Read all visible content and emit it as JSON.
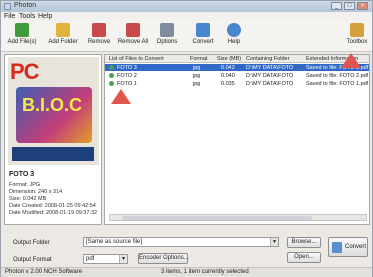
{
  "window": {
    "title": "Photon"
  },
  "menu": [
    "File",
    "Tools",
    "Help"
  ],
  "toolbar": [
    {
      "label": "Add File(s)",
      "icon": "add-files-icon",
      "color": "#3f9a3c"
    },
    {
      "label": "Add Folder",
      "icon": "add-folder-icon",
      "color": "#e0b33c"
    },
    {
      "label": "Remove",
      "icon": "remove-icon",
      "color": "#c94a4a"
    },
    {
      "label": "Remove All",
      "icon": "remove-all-icon",
      "color": "#c94a4a"
    },
    {
      "label": "Options",
      "icon": "options-icon",
      "color": "#7e8ca0"
    },
    {
      "label": "Convert",
      "icon": "convert-icon",
      "color": "#4a86cf"
    },
    {
      "label": "Help",
      "icon": "help-icon",
      "color": "#4a86cf"
    },
    {
      "label": "Toolbox",
      "icon": "toolbox-icon",
      "color": "#d6a13a"
    }
  ],
  "preview": {
    "cover_title": "PC",
    "cover_big": "B.I.O.C",
    "file_name": "FOTO 3",
    "format": "Format: JPG",
    "dimension": "Dimension: 240 x 314",
    "size": "Size: 0.042 MB",
    "created": "Date Created: 2008-01-25 09:42:54",
    "modified": "Date Modified: 2008-01-19 09:37:32"
  },
  "list": {
    "headers": [
      "List of Files to Convert",
      "Format",
      "Size (MB)",
      "Containing Folder",
      "Extended Information"
    ],
    "rows": [
      {
        "name": "FOTO 3",
        "format": "jpg",
        "size": "0.042",
        "folder": "D:\\MY DATA\\FOTO",
        "info": "Saved to file: FOTO 3.pdf",
        "selected": true
      },
      {
        "name": "FOTO 2",
        "format": "jpg",
        "size": "0.040",
        "folder": "D:\\MY DATA\\FOTO",
        "info": "Saved to file: FOTO 2.pdf",
        "selected": false
      },
      {
        "name": "FOTO 1",
        "format": "jpg",
        "size": "0.035",
        "folder": "D:\\MY DATA\\FOTO",
        "info": "Saved to file: FOTO 1.pdf",
        "selected": false
      }
    ]
  },
  "output": {
    "folder_label": "Output Folder",
    "folder_value": "[Same as source file]",
    "format_label": "Output Format",
    "format_value": "pdf",
    "encoder_button": "Encoder Options...",
    "browse_button": "Browse...",
    "open_button": "Open...",
    "convert_button": "Convert"
  },
  "status": {
    "left": "Photon v 2.00  NCH Software",
    "center": "3 items, 1 item currently selected"
  },
  "colors": {
    "selection": "#3169c6",
    "arrow": "#e0564e"
  }
}
